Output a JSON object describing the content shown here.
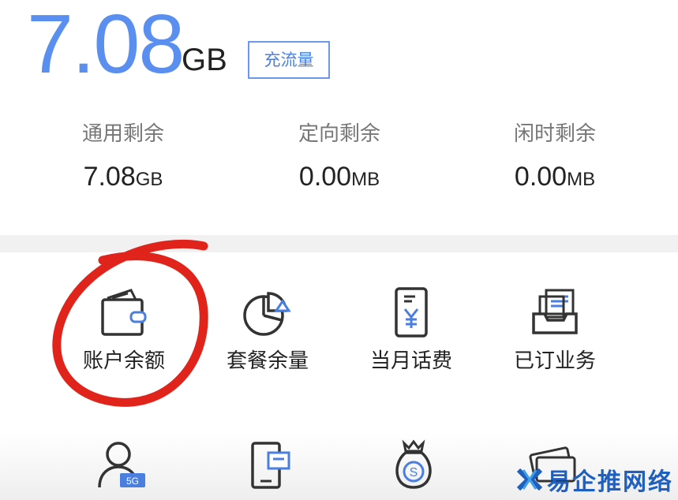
{
  "balance": {
    "value": "7.08",
    "unit": "GB"
  },
  "recharge_label": "充流量",
  "stats": [
    {
      "label": "通用剩余",
      "value": "7.08",
      "unit": "GB"
    },
    {
      "label": "定向剩余",
      "value": "0.00",
      "unit": "MB"
    },
    {
      "label": "闲时剩余",
      "value": "0.00",
      "unit": "MB"
    }
  ],
  "services": [
    {
      "label": "账户余额",
      "icon": "wallet-icon"
    },
    {
      "label": "套餐余量",
      "icon": "pie-chart-icon"
    },
    {
      "label": "当月话费",
      "icon": "phone-bill-icon"
    },
    {
      "label": "已订业务",
      "icon": "inbox-tray-icon"
    }
  ],
  "more_icons": [
    "user-5g-icon",
    "phone-card-icon",
    "money-bag-icon",
    "cards-icon"
  ],
  "more_badge": "5G",
  "watermark": "易企推网络",
  "colors": {
    "accent": "#5b8fef",
    "annotation": "#e0241b",
    "watermark": "#1f5fbf"
  }
}
